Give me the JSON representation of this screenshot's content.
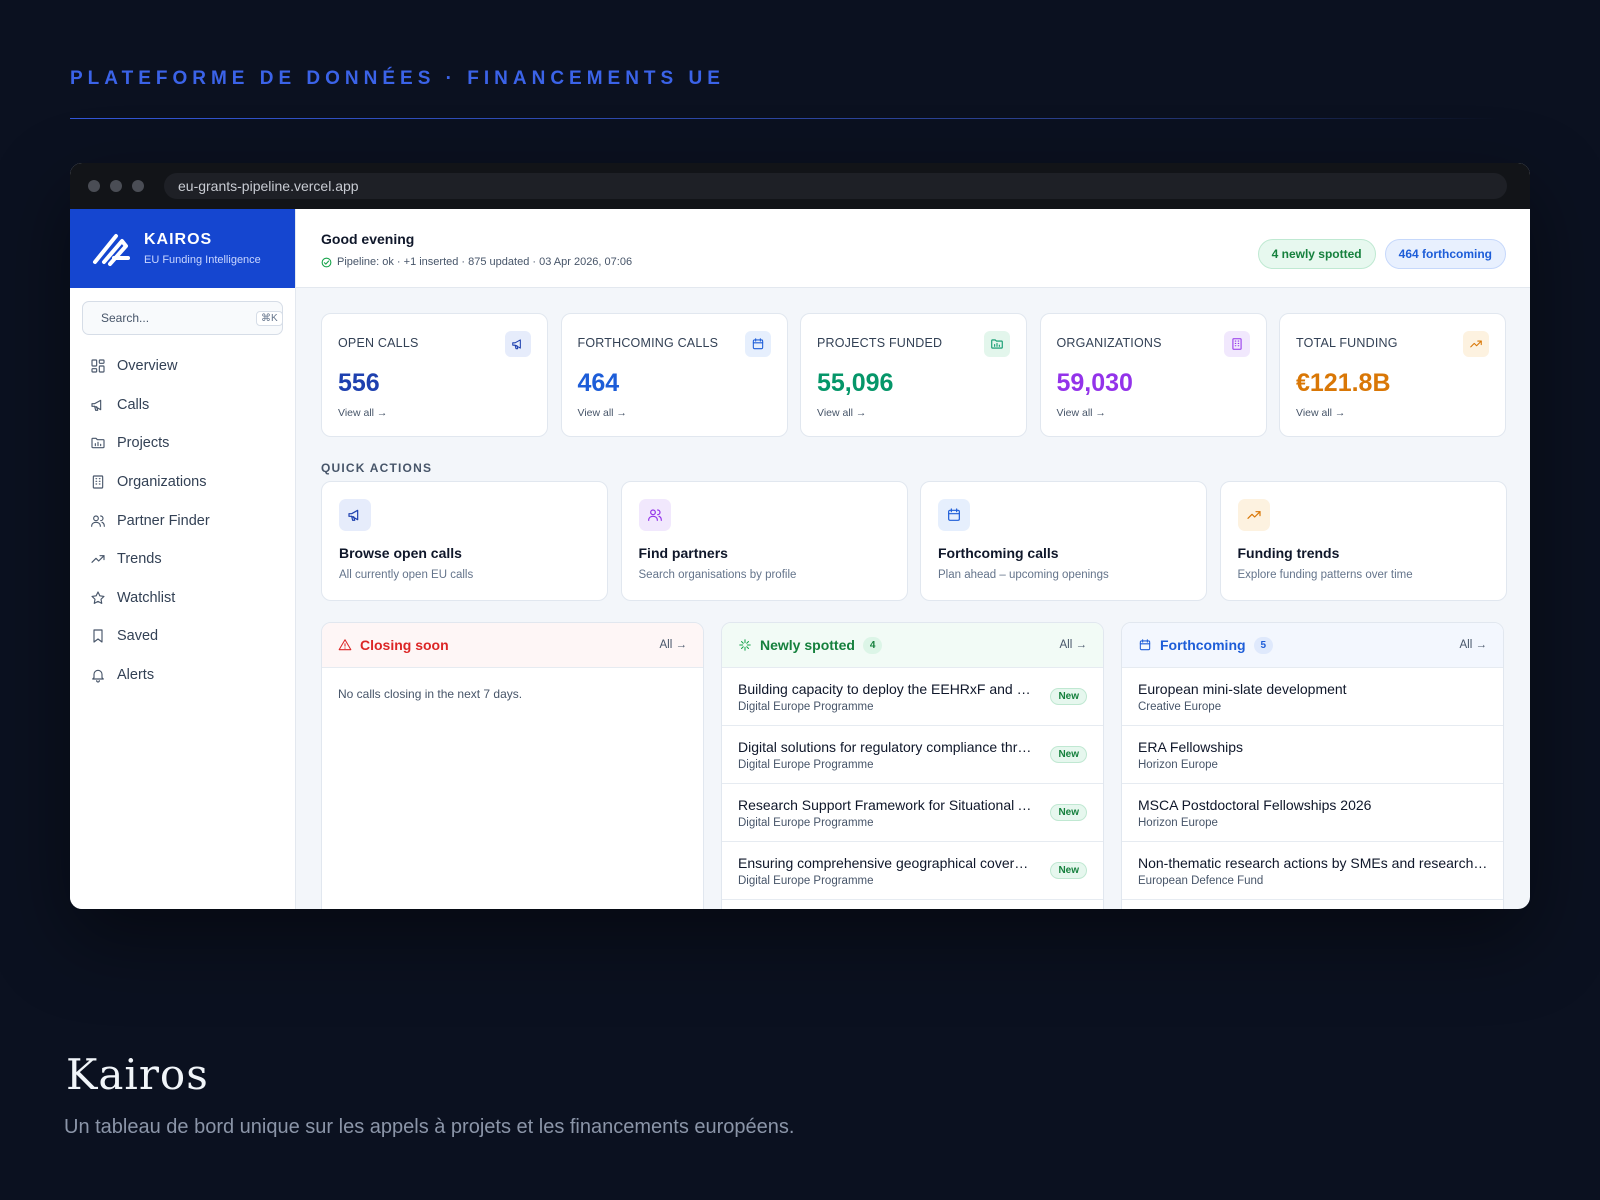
{
  "eyebrow": "PLATEFORME DE DONNÉES · FINANCEMENTS UE",
  "browser": {
    "url": "eu-grants-pipeline.vercel.app"
  },
  "brand": {
    "name": "KAIROS",
    "tagline": "EU Funding Intelligence",
    "color": "#1546d0"
  },
  "search": {
    "placeholder": "Search...",
    "shortcut": "⌘K"
  },
  "sidebar": {
    "items": [
      {
        "label": "Overview",
        "icon": "grid-icon"
      },
      {
        "label": "Calls",
        "icon": "megaphone-icon"
      },
      {
        "label": "Projects",
        "icon": "folder-chart-icon"
      },
      {
        "label": "Organizations",
        "icon": "building-icon"
      },
      {
        "label": "Partner Finder",
        "icon": "users-icon"
      },
      {
        "label": "Trends",
        "icon": "trend-icon"
      },
      {
        "label": "Watchlist",
        "icon": "star-icon"
      },
      {
        "label": "Saved",
        "icon": "bookmark-icon"
      },
      {
        "label": "Alerts",
        "icon": "bell-icon"
      }
    ]
  },
  "header": {
    "greeting": "Good evening",
    "status": "Pipeline: ok · +1 inserted · 875 updated · 03 Apr 2026, 07:06",
    "pill_new": "4 newly spotted",
    "pill_forthcoming": "464 forthcoming"
  },
  "stats": [
    {
      "label": "OPEN CALLS",
      "value": "556",
      "link": "View all →",
      "color": "#1e40af",
      "icon": "megaphone-icon"
    },
    {
      "label": "FORTHCOMING CALLS",
      "value": "464",
      "link": "View all →",
      "color": "#1d5dd8",
      "icon": "calendar-icon"
    },
    {
      "label": "PROJECTS FUNDED",
      "value": "55,096",
      "link": "View all →",
      "color": "#059669",
      "icon": "folder-chart-icon"
    },
    {
      "label": "ORGANIZATIONS",
      "value": "59,030",
      "link": "View all →",
      "color": "#9333ea",
      "icon": "building-icon"
    },
    {
      "label": "TOTAL FUNDING",
      "value": "€121.8B",
      "link": "View all →",
      "color": "#d97706",
      "icon": "trend-icon"
    }
  ],
  "quick_actions": {
    "title": "QUICK ACTIONS",
    "items": [
      {
        "name": "Browse open calls",
        "desc": "All currently open EU calls",
        "icon": "megaphone-icon"
      },
      {
        "name": "Find partners",
        "desc": "Search organisations by profile",
        "icon": "users-icon"
      },
      {
        "name": "Forthcoming calls",
        "desc": "Plan ahead – upcoming openings",
        "icon": "calendar-icon"
      },
      {
        "name": "Funding trends",
        "desc": "Explore funding patterns over time",
        "icon": "trend-icon"
      }
    ]
  },
  "panels": {
    "closing": {
      "title": "Closing soon",
      "all": "All →",
      "empty": "No calls closing in the next 7 days."
    },
    "newly": {
      "title": "Newly spotted",
      "count": "4",
      "all": "All →",
      "badge": "New",
      "rows": [
        {
          "title": "Building capacity to deploy the EEHRxF and other European Health Data Space standards",
          "sub": "Digital Europe Programme"
        },
        {
          "title": "Digital solutions for regulatory compliance through data",
          "sub": "Digital Europe Programme"
        },
        {
          "title": "Research Support Framework for Situational Awareness",
          "sub": "Digital Europe Programme"
        },
        {
          "title": "Ensuring comprehensive geographical coverage of the network",
          "sub": "Digital Europe Programme"
        }
      ]
    },
    "forthcoming": {
      "title": "Forthcoming",
      "count": "5",
      "all": "All →",
      "rows": [
        {
          "title": "European mini-slate development",
          "sub": "Creative Europe"
        },
        {
          "title": "ERA Fellowships",
          "sub": "Horizon Europe"
        },
        {
          "title": "MSCA Postdoctoral Fellowships 2026",
          "sub": "Horizon Europe"
        },
        {
          "title": "Non-thematic research actions by SMEs and research organisations",
          "sub": "European Defence Fund"
        }
      ]
    }
  },
  "footer": {
    "title": "Kairos",
    "subtitle": "Un tableau de bord unique sur les appels à projets et les financements européens."
  }
}
